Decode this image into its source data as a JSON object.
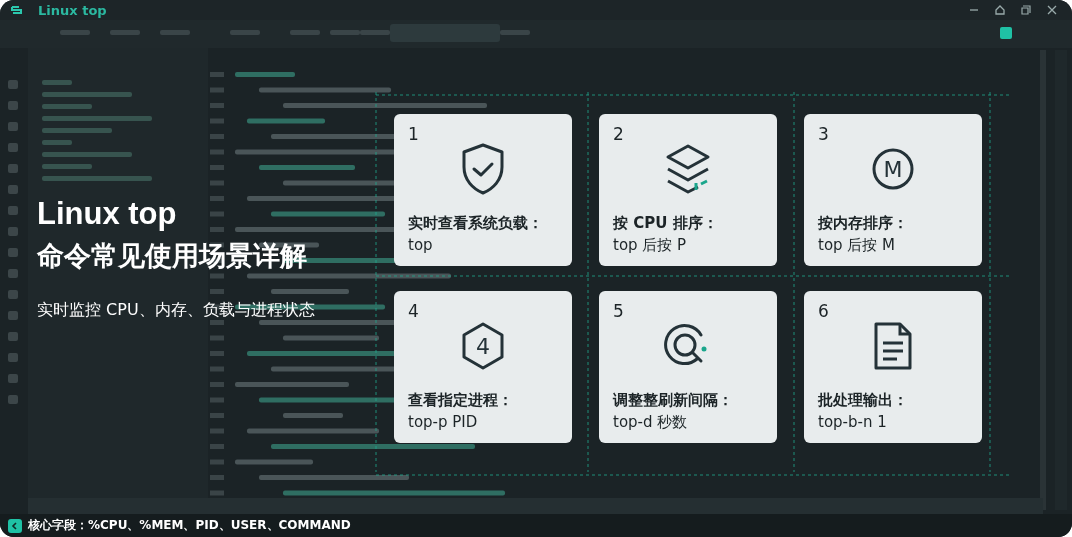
{
  "window": {
    "title": "Linux top"
  },
  "hero": {
    "title": "Linux top",
    "subtitle": "命令常见使用场景详解",
    "tagline": "实时监控 CPU、内存、负载与进程状态"
  },
  "cards": [
    {
      "number": "1",
      "kind": "shield",
      "title": "实时查看系统负载：",
      "command": "top"
    },
    {
      "number": "2",
      "kind": "layers",
      "title": "按 CPU 排序：",
      "command": "top 后按 P"
    },
    {
      "number": "3",
      "kind": "circle",
      "glyph": "M",
      "title": "按内存排序：",
      "command": "top 后按 M"
    },
    {
      "number": "4",
      "kind": "hexagon",
      "glyph": "4",
      "title": "查看指定进程：",
      "command": "top-p PID"
    },
    {
      "number": "5",
      "kind": "search",
      "title": "调整整刷新间隔：",
      "command": "top-d 秒数"
    },
    {
      "number": "6",
      "kind": "document",
      "title": "批处理输出：",
      "command": "top-b-n 1"
    }
  ],
  "status_bar": {
    "text": "核心字段：%CPU、%MEM、PID、USER、COMMAND"
  }
}
